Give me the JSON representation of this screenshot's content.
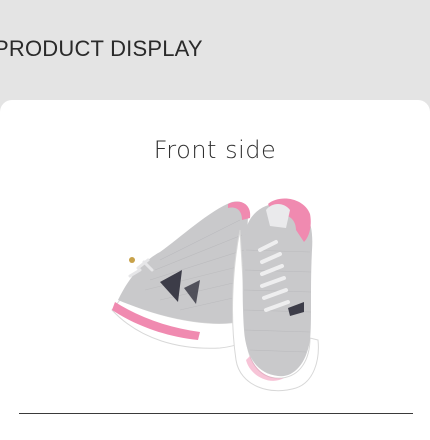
{
  "header": {
    "title": "PRODUCT DISPLAY"
  },
  "card": {
    "title": "Front side"
  },
  "image": {
    "subject": "pair of grey and pink knit running sneakers",
    "colors": {
      "knit": "#c9c9cb",
      "accent": "#f08ab0",
      "sole": "#ffffff",
      "detail": "#3c3c48"
    }
  }
}
